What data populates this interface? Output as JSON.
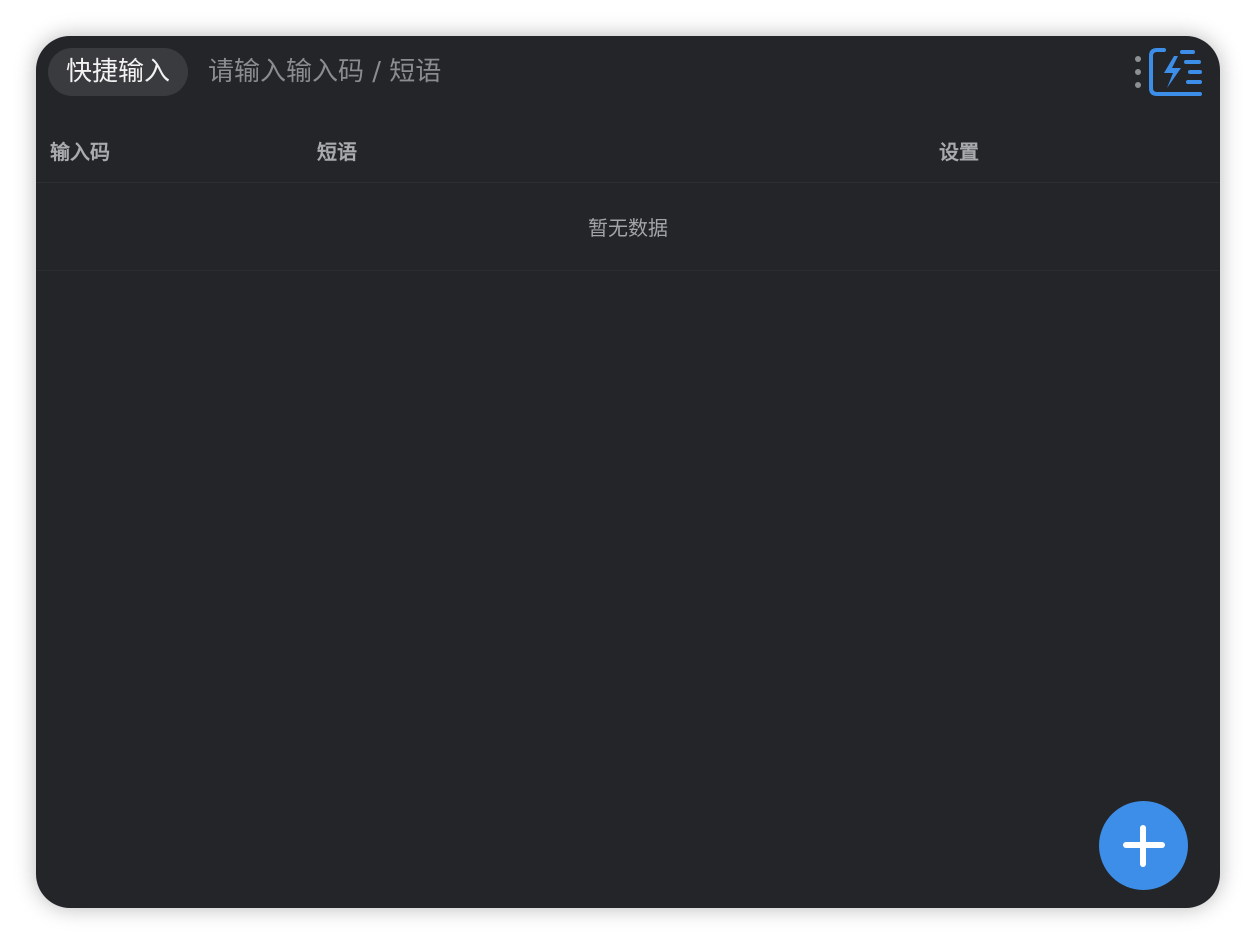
{
  "header": {
    "tag_label": "快捷输入",
    "search_placeholder": "请输入输入码 / 短语",
    "search_value": ""
  },
  "table": {
    "columns": [
      "输入码",
      "短语",
      "设置"
    ],
    "empty_text": "暂无数据"
  },
  "colors": {
    "background": "#242528",
    "accent": "#3d8ee8",
    "pill": "#3a3b3e"
  },
  "icons": {
    "menu": "more-vertical-icon",
    "logo": "quick-input-logo-icon",
    "add": "plus-icon"
  }
}
